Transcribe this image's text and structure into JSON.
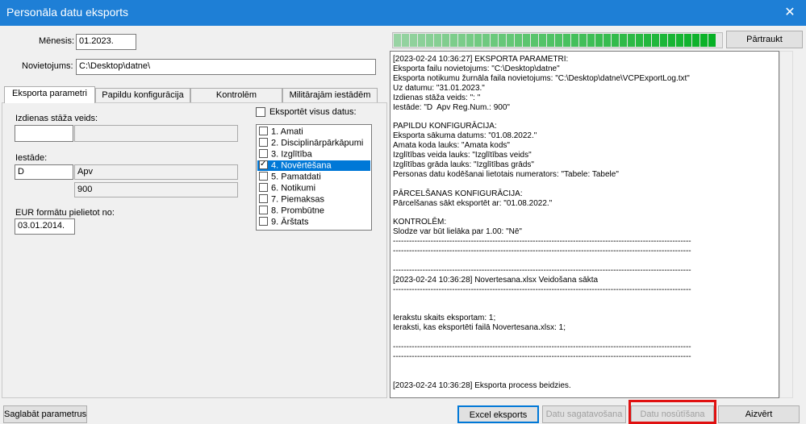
{
  "window": {
    "title": "Personāla datu eksports",
    "close_glyph": "✕"
  },
  "header": {
    "month_label": "Mēnesis:",
    "month_value": "01.2023.",
    "location_label": "Novietojums:",
    "location_value": "C:\\Desktop\\datne\\"
  },
  "tabs": [
    {
      "label": "Eksporta parametri",
      "active": true
    },
    {
      "label": "Papildu konfigurācija",
      "active": false
    },
    {
      "label": "Kontrolēm",
      "active": false
    },
    {
      "label": "Militārajām iestādēm",
      "active": false
    }
  ],
  "params": {
    "seniority_label": "Izdienas stāža veids:",
    "seniority_code": "",
    "seniority_name": "",
    "institution_label": "Iestāde:",
    "institution_code": "D",
    "institution_name": "Apv",
    "institution_number": "900",
    "eur_label": "EUR formātu pielietot no:",
    "eur_value": "03.01.2014.",
    "export_all_label": "Eksportēt visus datus:",
    "export_all_checked": false
  },
  "checklist": [
    {
      "label": "1. Amati",
      "checked": false,
      "selected": false
    },
    {
      "label": "2. Disciplinārpārkāpumi",
      "checked": false,
      "selected": false
    },
    {
      "label": "3. Izglītība",
      "checked": false,
      "selected": false
    },
    {
      "label": "4. Novērtēšana",
      "checked": true,
      "selected": true
    },
    {
      "label": "5. Pamatdati",
      "checked": false,
      "selected": false
    },
    {
      "label": "6. Notikumi",
      "checked": false,
      "selected": false
    },
    {
      "label": "7. Piemaksas",
      "checked": false,
      "selected": false
    },
    {
      "label": "8. Prombūtne",
      "checked": false,
      "selected": false
    },
    {
      "label": "9. Ārštats",
      "checked": false,
      "selected": false
    }
  ],
  "progress": {
    "percent": 100,
    "stop_label": "Pārtraukt",
    "color": "#06b025"
  },
  "log": {
    "lines": [
      "[2023-02-24 10:36:27] EKSPORTA PARAMETRI:",
      "Eksporta failu novietojums: \"C:\\Desktop\\datne\"",
      "Eksporta notikumu žurnāla faila novietojums: \"C:\\Desktop\\datne\\VCPExportLog.txt\"",
      "Uz datumu: \"31.01.2023.\"",
      "Izdienas stāža veids: \": \"",
      "Iestāde: \"D  Apv Reg.Num.: 900\"",
      "",
      "PAPILDU KONFIGURĀCIJA:",
      "Eksporta sākuma datums: \"01.08.2022.\"",
      "Amata koda lauks: \"Amata kods\"",
      "Izglītības veida lauks: \"Izglītības veids\"",
      "Izglītības grāda lauks: \"Izglītības grāds\"",
      "Personas datu kodēšanai lietotais numerators: \"Tabele: Tabele\"",
      "",
      "PĀRCELŠANAS KONFIGURĀCIJA:",
      "Pārcelšanas sākt eksportēt ar: \"01.08.2022.\"",
      "",
      "KONTROLĒM:",
      "Slodze var būt lielāka par 1.00: \"Nē\"",
      "---------------------------------------------------------------------------------------------------------------",
      "---------------------------------------------------------------------------------------------------------------",
      "",
      "---------------------------------------------------------------------------------------------------------------",
      "[2023-02-24 10:36:28] Novertesana.xlsx Veidošana sākta",
      "---------------------------------------------------------------------------------------------------------------",
      "",
      "",
      "Ierakstu skaits eksportam: 1;",
      "Ieraksti, kas eksportēti failā Novertesana.xlsx: 1;",
      "",
      "---------------------------------------------------------------------------------------------------------------",
      "---------------------------------------------------------------------------------------------------------------",
      "",
      "",
      "[2023-02-24 10:36:28] Eksporta process beidzies."
    ]
  },
  "footer": {
    "save_params": "Saglabāt parametrus",
    "excel_export": "Excel eksports",
    "prepare_data": "Datu sagatavošana",
    "send_data": "Datu nosūtīšana",
    "close": "Aizvērt"
  }
}
